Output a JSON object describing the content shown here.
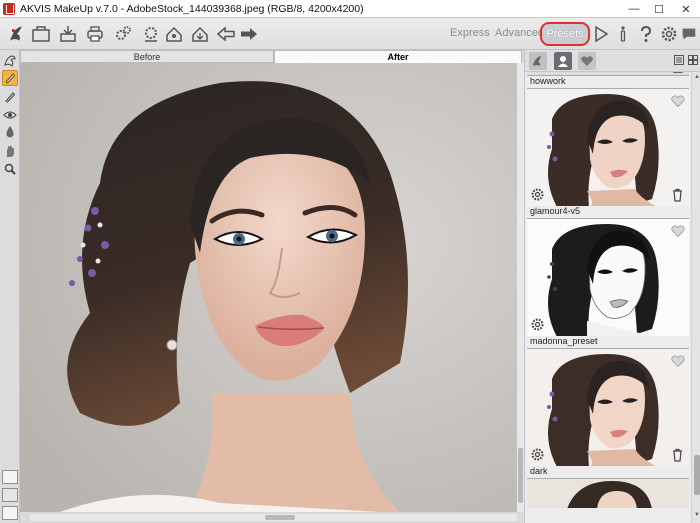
{
  "window": {
    "title": "AKVIS MakeUp v.7.0 - AdobeStock_144039368.jpeg (RGB/8, 4200x4200)",
    "minimize_glyph": "—",
    "maximize_glyph": "☐",
    "close_glyph": "✕"
  },
  "toolbar": {
    "icons": [
      "open-icon",
      "save-icon",
      "print-icon",
      "batch-icon",
      "preferences-icon",
      "import-icon",
      "export-icon",
      "undo-icon",
      "redo-icon"
    ],
    "modes": {
      "express": "Express",
      "advanced": "Advanced",
      "presets": "Presets"
    },
    "right_icons": [
      "run-icon",
      "info-icon",
      "help-icon",
      "settings-icon",
      "feedback-icon"
    ],
    "presets_highlight_color": "#e0312b"
  },
  "left_tools": [
    "cosmetic-tool-icon",
    "brush-tool-icon",
    "pencil-tool-icon",
    "eye-tool-icon",
    "drop-tool-icon",
    "hand-tool-icon",
    "zoom-tool-icon"
  ],
  "view_tabs": {
    "before": "Before",
    "after": "After"
  },
  "preset_panel": {
    "tabs": [
      "akvis-presets-tab",
      "user-presets-tab",
      "favorites-tab"
    ],
    "items": [
      {
        "name": "howwork",
        "style": "color"
      },
      {
        "name": "glamour4-v5",
        "style": "sketch"
      },
      {
        "name": "madonna_preset",
        "style": "color"
      },
      {
        "name": "dark",
        "style": "color"
      }
    ]
  },
  "colors": {
    "accent": "#f0b54a",
    "background": "#d9dadc"
  }
}
